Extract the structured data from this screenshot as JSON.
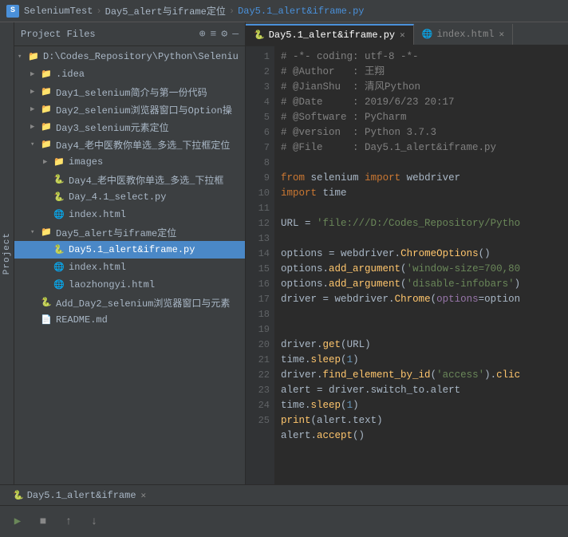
{
  "titlebar": {
    "app_name": "SeleniumTest",
    "breadcrumb": [
      "SeleniumTest",
      "Day5_alert与iframe定位",
      "Day5.1_alert&iframe.py"
    ],
    "sep": "›"
  },
  "sidebar": {
    "title": "Project Files",
    "icons": [
      "⊕",
      "≡",
      "⚙",
      "—"
    ],
    "root_path": "D:\\Codes_Repository\\Python\\Seleniu",
    "items": [
      {
        "label": ".idea",
        "type": "folder",
        "depth": 1,
        "expanded": false
      },
      {
        "label": "Day1_selenium简介与第一份代码",
        "type": "folder",
        "depth": 1,
        "expanded": false
      },
      {
        "label": "Day2_selenium浏览器窗口与Option操",
        "type": "folder",
        "depth": 1,
        "expanded": false
      },
      {
        "label": "Day3_selenium元素定位",
        "type": "folder",
        "depth": 1,
        "expanded": false
      },
      {
        "label": "Day4_老中医教你单选_多选_下拉框定位",
        "type": "folder",
        "depth": 1,
        "expanded": true
      },
      {
        "label": "images",
        "type": "folder",
        "depth": 2,
        "expanded": false
      },
      {
        "label": "Day4_老中医教你单选_多选_下拉框",
        "type": "py",
        "depth": 2,
        "expanded": false
      },
      {
        "label": "Day_4.1_select.py",
        "type": "py",
        "depth": 2
      },
      {
        "label": "index.html",
        "type": "html",
        "depth": 2
      },
      {
        "label": "Day5_alert与iframe定位",
        "type": "folder",
        "depth": 1,
        "expanded": true
      },
      {
        "label": "Day5.1_alert&iframe.py",
        "type": "py",
        "depth": 2,
        "selected": true
      },
      {
        "label": "index.html",
        "type": "html",
        "depth": 2,
        "selected": false
      },
      {
        "label": "laozhongyi.html",
        "type": "html",
        "depth": 2
      },
      {
        "label": "Add_Day2_selenium浏览器窗口与元素",
        "type": "py",
        "depth": 1
      },
      {
        "label": "README.md",
        "type": "md",
        "depth": 1
      }
    ]
  },
  "tabs": [
    {
      "label": "Day5.1_alert&iframe.py",
      "type": "py",
      "active": true
    },
    {
      "label": "index.html",
      "type": "html",
      "active": false
    }
  ],
  "code": {
    "lines": [
      {
        "n": 1,
        "text": "# -*- coding: utf-8 -*-"
      },
      {
        "n": 2,
        "text": "# @Author   : 王翔"
      },
      {
        "n": 3,
        "text": "# @JianShu  : 清风Python"
      },
      {
        "n": 4,
        "text": "# @Date     : 2019/6/23 20:17"
      },
      {
        "n": 5,
        "text": "# @Software : PyCharm"
      },
      {
        "n": 6,
        "text": "# @version  : Python 3.7.3"
      },
      {
        "n": 7,
        "text": "# @File     : Day5.1_alert&iframe.py"
      },
      {
        "n": 8,
        "text": ""
      },
      {
        "n": 9,
        "text": "from selenium import webdriver"
      },
      {
        "n": 10,
        "text": "import time"
      },
      {
        "n": 11,
        "text": ""
      },
      {
        "n": 12,
        "text": "URL = 'file:///D:/Codes_Repository/Pytho"
      },
      {
        "n": 13,
        "text": ""
      },
      {
        "n": 14,
        "text": "options = webdriver.ChromeOptions()"
      },
      {
        "n": 15,
        "text": "options.add_argument('window-size=700,80"
      },
      {
        "n": 16,
        "text": "options.add_argument('disable-infobars')"
      },
      {
        "n": 17,
        "text": "driver = webdriver.Chrome(options=option"
      },
      {
        "n": 18,
        "text": ""
      },
      {
        "n": 19,
        "text": "driver.get(URL)"
      },
      {
        "n": 20,
        "text": "time.sleep(1)"
      },
      {
        "n": 21,
        "text": "driver.find_element_by_id('access').clic"
      },
      {
        "n": 22,
        "text": "alert = driver.switch_to.alert"
      },
      {
        "n": 23,
        "text": "time.sleep(1)"
      },
      {
        "n": 24,
        "text": "print(alert.text)"
      },
      {
        "n": 25,
        "text": "alert.accept()"
      }
    ]
  },
  "run_tab": {
    "label": "Day5.1_alert&iframe",
    "icon": "🐍"
  },
  "bottom_buttons": {
    "run": "▶",
    "stop": "■",
    "up": "↑",
    "down": "↓"
  },
  "project_label": "Project"
}
